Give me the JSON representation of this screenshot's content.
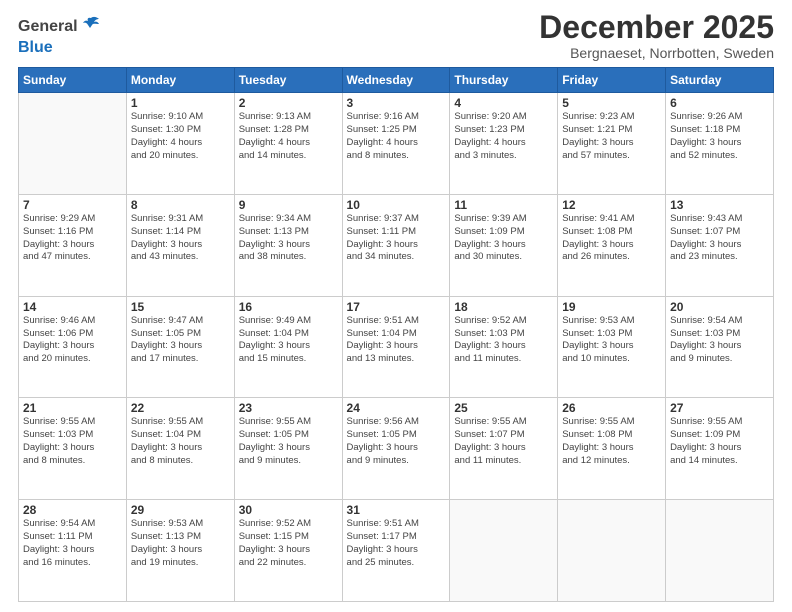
{
  "header": {
    "logo_general": "General",
    "logo_blue": "Blue",
    "month_title": "December 2025",
    "location": "Bergnaeset, Norrbotten, Sweden"
  },
  "weekdays": [
    "Sunday",
    "Monday",
    "Tuesday",
    "Wednesday",
    "Thursday",
    "Friday",
    "Saturday"
  ],
  "weeks": [
    [
      {
        "day": "",
        "info": ""
      },
      {
        "day": "1",
        "info": "Sunrise: 9:10 AM\nSunset: 1:30 PM\nDaylight: 4 hours\nand 20 minutes."
      },
      {
        "day": "2",
        "info": "Sunrise: 9:13 AM\nSunset: 1:28 PM\nDaylight: 4 hours\nand 14 minutes."
      },
      {
        "day": "3",
        "info": "Sunrise: 9:16 AM\nSunset: 1:25 PM\nDaylight: 4 hours\nand 8 minutes."
      },
      {
        "day": "4",
        "info": "Sunrise: 9:20 AM\nSunset: 1:23 PM\nDaylight: 4 hours\nand 3 minutes."
      },
      {
        "day": "5",
        "info": "Sunrise: 9:23 AM\nSunset: 1:21 PM\nDaylight: 3 hours\nand 57 minutes."
      },
      {
        "day": "6",
        "info": "Sunrise: 9:26 AM\nSunset: 1:18 PM\nDaylight: 3 hours\nand 52 minutes."
      }
    ],
    [
      {
        "day": "7",
        "info": "Sunrise: 9:29 AM\nSunset: 1:16 PM\nDaylight: 3 hours\nand 47 minutes."
      },
      {
        "day": "8",
        "info": "Sunrise: 9:31 AM\nSunset: 1:14 PM\nDaylight: 3 hours\nand 43 minutes."
      },
      {
        "day": "9",
        "info": "Sunrise: 9:34 AM\nSunset: 1:13 PM\nDaylight: 3 hours\nand 38 minutes."
      },
      {
        "day": "10",
        "info": "Sunrise: 9:37 AM\nSunset: 1:11 PM\nDaylight: 3 hours\nand 34 minutes."
      },
      {
        "day": "11",
        "info": "Sunrise: 9:39 AM\nSunset: 1:09 PM\nDaylight: 3 hours\nand 30 minutes."
      },
      {
        "day": "12",
        "info": "Sunrise: 9:41 AM\nSunset: 1:08 PM\nDaylight: 3 hours\nand 26 minutes."
      },
      {
        "day": "13",
        "info": "Sunrise: 9:43 AM\nSunset: 1:07 PM\nDaylight: 3 hours\nand 23 minutes."
      }
    ],
    [
      {
        "day": "14",
        "info": "Sunrise: 9:46 AM\nSunset: 1:06 PM\nDaylight: 3 hours\nand 20 minutes."
      },
      {
        "day": "15",
        "info": "Sunrise: 9:47 AM\nSunset: 1:05 PM\nDaylight: 3 hours\nand 17 minutes."
      },
      {
        "day": "16",
        "info": "Sunrise: 9:49 AM\nSunset: 1:04 PM\nDaylight: 3 hours\nand 15 minutes."
      },
      {
        "day": "17",
        "info": "Sunrise: 9:51 AM\nSunset: 1:04 PM\nDaylight: 3 hours\nand 13 minutes."
      },
      {
        "day": "18",
        "info": "Sunrise: 9:52 AM\nSunset: 1:03 PM\nDaylight: 3 hours\nand 11 minutes."
      },
      {
        "day": "19",
        "info": "Sunrise: 9:53 AM\nSunset: 1:03 PM\nDaylight: 3 hours\nand 10 minutes."
      },
      {
        "day": "20",
        "info": "Sunrise: 9:54 AM\nSunset: 1:03 PM\nDaylight: 3 hours\nand 9 minutes."
      }
    ],
    [
      {
        "day": "21",
        "info": "Sunrise: 9:55 AM\nSunset: 1:03 PM\nDaylight: 3 hours\nand 8 minutes."
      },
      {
        "day": "22",
        "info": "Sunrise: 9:55 AM\nSunset: 1:04 PM\nDaylight: 3 hours\nand 8 minutes."
      },
      {
        "day": "23",
        "info": "Sunrise: 9:55 AM\nSunset: 1:05 PM\nDaylight: 3 hours\nand 9 minutes."
      },
      {
        "day": "24",
        "info": "Sunrise: 9:56 AM\nSunset: 1:05 PM\nDaylight: 3 hours\nand 9 minutes."
      },
      {
        "day": "25",
        "info": "Sunrise: 9:55 AM\nSunset: 1:07 PM\nDaylight: 3 hours\nand 11 minutes."
      },
      {
        "day": "26",
        "info": "Sunrise: 9:55 AM\nSunset: 1:08 PM\nDaylight: 3 hours\nand 12 minutes."
      },
      {
        "day": "27",
        "info": "Sunrise: 9:55 AM\nSunset: 1:09 PM\nDaylight: 3 hours\nand 14 minutes."
      }
    ],
    [
      {
        "day": "28",
        "info": "Sunrise: 9:54 AM\nSunset: 1:11 PM\nDaylight: 3 hours\nand 16 minutes."
      },
      {
        "day": "29",
        "info": "Sunrise: 9:53 AM\nSunset: 1:13 PM\nDaylight: 3 hours\nand 19 minutes."
      },
      {
        "day": "30",
        "info": "Sunrise: 9:52 AM\nSunset: 1:15 PM\nDaylight: 3 hours\nand 22 minutes."
      },
      {
        "day": "31",
        "info": "Sunrise: 9:51 AM\nSunset: 1:17 PM\nDaylight: 3 hours\nand 25 minutes."
      },
      {
        "day": "",
        "info": ""
      },
      {
        "day": "",
        "info": ""
      },
      {
        "day": "",
        "info": ""
      }
    ]
  ]
}
